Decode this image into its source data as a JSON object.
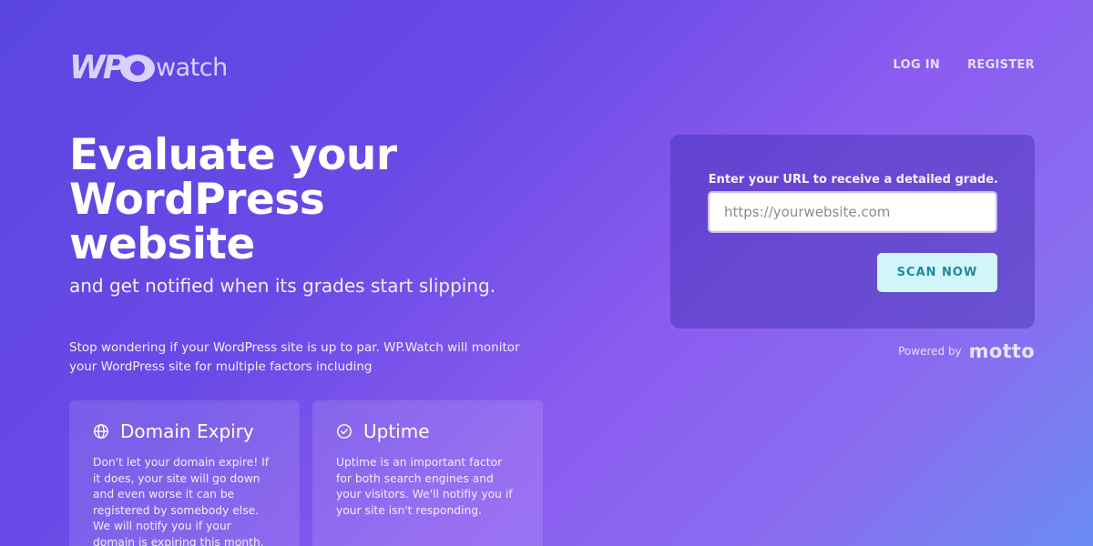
{
  "brand": {
    "logo_left": "WP",
    "logo_right": "watch"
  },
  "nav": {
    "login": "LOG IN",
    "register": "REGISTER"
  },
  "hero": {
    "line1": "Evaluate your",
    "line2": "WordPress",
    "line3": "website",
    "subhead": "and get notified when its grades start slipping.",
    "intro": "Stop wondering if your WordPress site is up to par. WP.Watch will monitor your WordPress site for multiple factors including"
  },
  "features": [
    {
      "icon": "globe-icon",
      "title": "Domain Expiry",
      "desc": "Don't let your domain expire! If it does, your site will go down and even worse it can be registered by somebody else. We will notify you if your domain is expiring this month."
    },
    {
      "icon": "check-circle-icon",
      "title": "Uptime",
      "desc": "Uptime is an important factor for both search engines and your visitors. We'll notifiy you if your site isn't responding."
    }
  ],
  "scan": {
    "label": "Enter your URL to receive a detailed grade.",
    "placeholder": "https://yourwebsite.com",
    "button": "SCAN NOW"
  },
  "powered": {
    "label": "Powered by",
    "brand": "motto"
  },
  "colors": {
    "background_start": "#5b45e0",
    "background_end": "#6a8cf2",
    "button_bg": "#d2f7fb",
    "button_text": "#1d8a9a"
  }
}
